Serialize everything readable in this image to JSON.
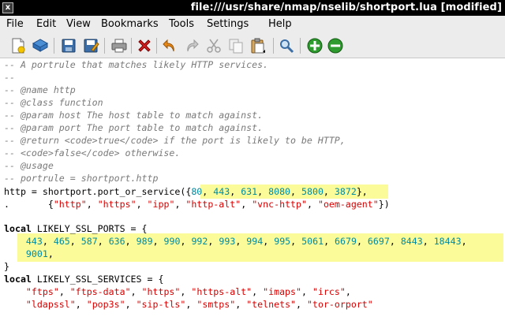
{
  "window": {
    "title": "file:///usr/share/nmap/nselib/shortport.lua [modified]",
    "close_glyph": "x"
  },
  "menubar": {
    "items": [
      "File",
      "Edit",
      "View",
      "Bookmarks",
      "Tools",
      "Settings",
      "Help"
    ]
  },
  "toolbar": {
    "buttons": [
      "new-icon",
      "open-icon",
      "save-icon",
      "save-as-icon",
      "print-icon",
      "close-icon",
      "undo-icon",
      "redo-icon",
      "cut-icon",
      "copy-icon",
      "paste-icon",
      "find-icon",
      "zoom-in-icon",
      "zoom-out-icon"
    ]
  },
  "editor": {
    "comments": [
      "-- A portrule that matches likely HTTP services.",
      "--",
      "-- @name http",
      "-- @class function",
      "-- @param host The host table to match against.",
      "-- @param port The port table to match against.",
      "-- @return <code>true</code> if the port is likely to be HTTP,",
      "-- <code>false</code> otherwise.",
      "-- @usage",
      "-- portrule = shortport.http"
    ],
    "http_assign": "http = shortport.port_or_service(",
    "http_ports": [
      "80",
      "443",
      "631",
      "8080",
      "5800",
      "3872"
    ],
    "http_services": [
      "\"http\"",
      "\"https\"",
      "\"ipp\"",
      "\"http-alt\"",
      "\"vnc-http\"",
      "\"oem-agent\""
    ],
    "ssl_ports_decl": {
      "keyword": "local",
      "rest": " LIKELY_SSL_PORTS = {"
    },
    "ssl_ports_line1": [
      "443",
      "465",
      "587",
      "636",
      "989",
      "990",
      "992",
      "993",
      "994",
      "995",
      "5061",
      "6679",
      "6697",
      "8443",
      "18443"
    ],
    "ssl_ports_line2": [
      "9001"
    ],
    "close_brace": "}",
    "ssl_services_decl": {
      "keyword": "local",
      "rest": " LIKELY_SSL_SERVICES = {"
    },
    "ssl_services_line1": [
      "\"ftps\"",
      "\"ftps-data\"",
      "\"https\"",
      "\"https-alt\"",
      "\"imaps\"",
      "\"ircs\""
    ],
    "ssl_services_line2": [
      "\"ldapssl\"",
      "\"pop3s\"",
      "\"sip-tls\"",
      "\"smtps\"",
      "\"telnets\"",
      "\"tor-orport\""
    ]
  }
}
